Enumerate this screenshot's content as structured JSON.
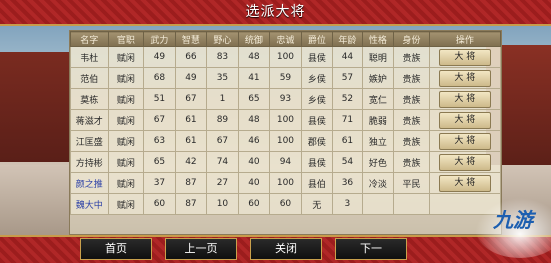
{
  "title": "选派大将",
  "columns": [
    "名字",
    "官职",
    "武力",
    "智慧",
    "野心",
    "统御",
    "忠诚",
    "爵位",
    "年龄",
    "性格",
    "身份",
    "操作"
  ],
  "rows": [
    [
      "韦杜",
      "赋闲",
      "49",
      "66",
      "83",
      "48",
      "100",
      "县侯",
      "44",
      "聪明",
      "贵族",
      "大 将"
    ],
    [
      "范伯",
      "赋闲",
      "68",
      "49",
      "35",
      "41",
      "59",
      "乡侯",
      "57",
      "嫉妒",
      "贵族",
      "大 将"
    ],
    [
      "莫栋",
      "赋闲",
      "51",
      "67",
      "1",
      "65",
      "93",
      "乡侯",
      "52",
      "宽仁",
      "贵族",
      "大 将"
    ],
    [
      "蒋滋才",
      "赋闲",
      "67",
      "61",
      "89",
      "48",
      "100",
      "县侯",
      "71",
      "脆弱",
      "贵族",
      "大 将"
    ],
    [
      "江匡盛",
      "赋闲",
      "63",
      "61",
      "67",
      "46",
      "100",
      "郡侯",
      "61",
      "独立",
      "贵族",
      "大 将"
    ],
    [
      "方持彬",
      "赋闲",
      "65",
      "42",
      "74",
      "40",
      "94",
      "县侯",
      "54",
      "好色",
      "贵族",
      "大 将"
    ],
    [
      "颜之推",
      "赋闲",
      "37",
      "87",
      "27",
      "40",
      "100",
      "县伯",
      "36",
      "冷淡",
      "平民",
      "大 将"
    ],
    [
      "魏大中",
      "赋闲",
      "60",
      "87",
      "10",
      "60",
      "60",
      "无",
      "3",
      "",
      "",
      ""
    ]
  ],
  "blue_name_rows": [
    6,
    7
  ],
  "nav": {
    "first": "首页",
    "prev": "上一页",
    "close": "关闭",
    "next": "下一"
  },
  "watermark": "九游"
}
